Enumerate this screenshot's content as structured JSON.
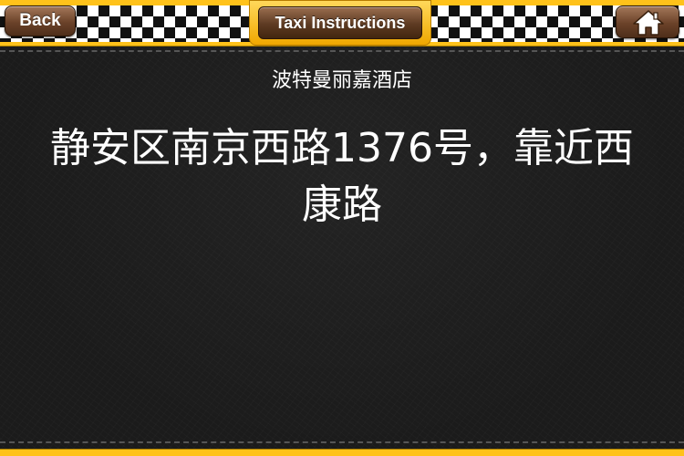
{
  "nav": {
    "back_label": "Back",
    "title": "Taxi Instructions",
    "home_icon": "home-icon"
  },
  "content": {
    "hotel_name": "波特曼丽嘉酒店",
    "address": "静安区南京西路1376号，靠近西康路"
  },
  "colors": {
    "taxi_yellow": "#ffc21a",
    "button_brown": "#6b4229",
    "text": "#ffffff",
    "background": "#1b1b1b"
  }
}
